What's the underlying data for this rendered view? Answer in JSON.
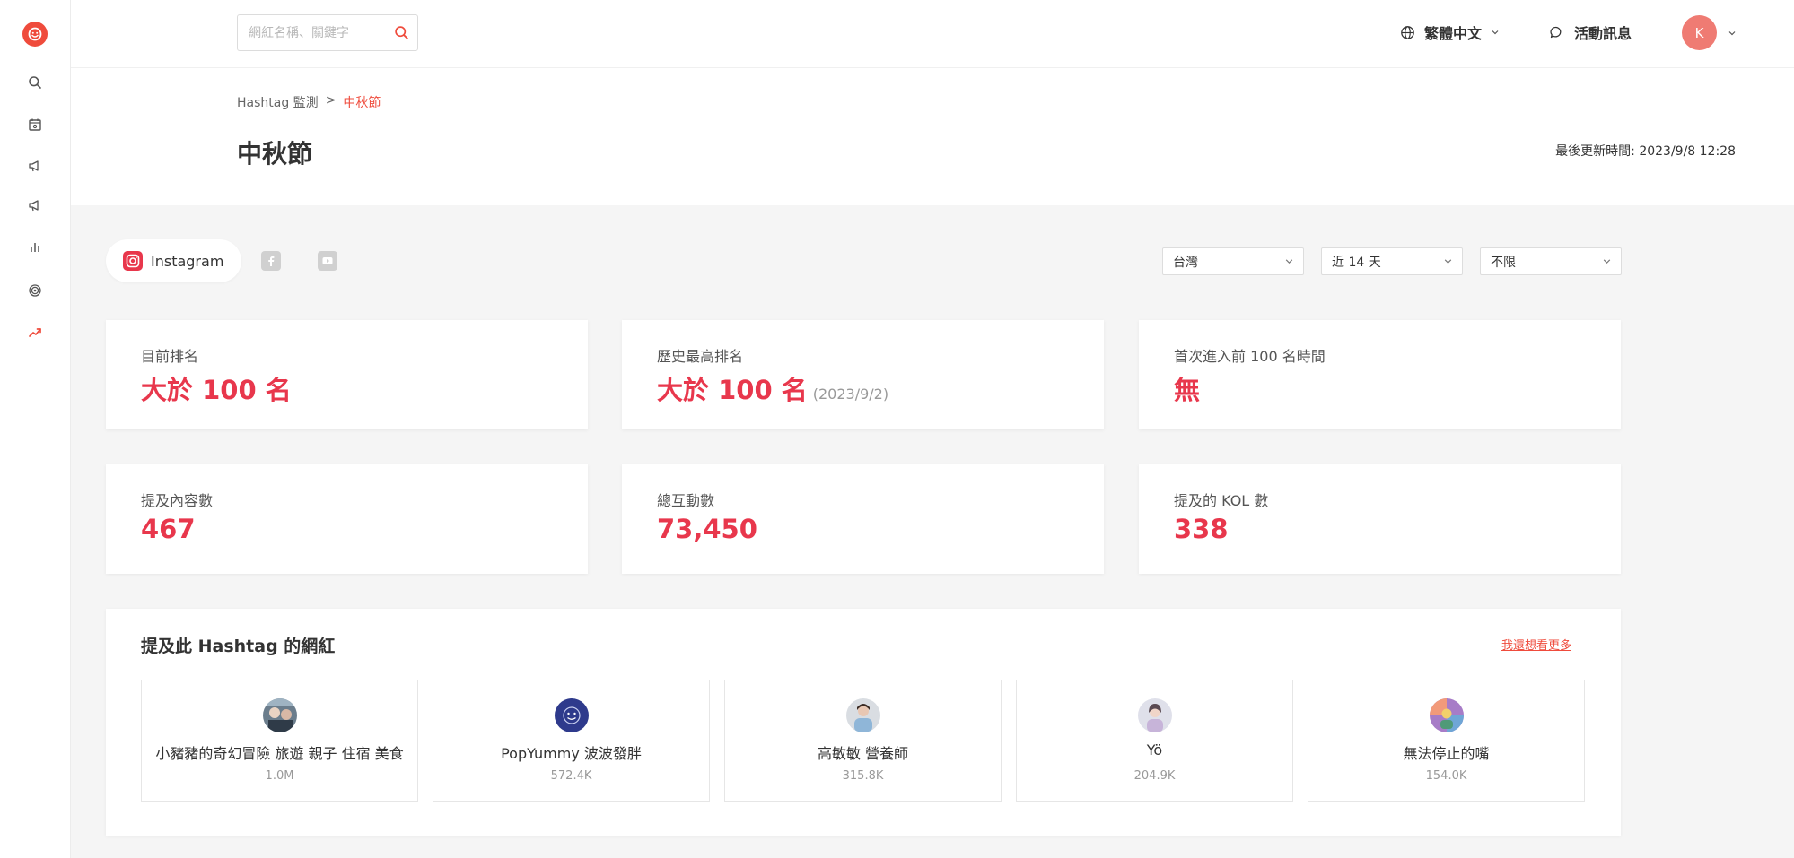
{
  "header": {
    "search_placeholder": "網紅名稱、關鍵字",
    "language": "繁體中文",
    "events_label": "活動訊息",
    "avatar_initial": "K"
  },
  "sidebar": {
    "items": [
      {
        "icon": "search-icon"
      },
      {
        "icon": "calendar-star-icon"
      },
      {
        "icon": "megaphone-icon"
      },
      {
        "icon": "megaphone-alt-icon"
      },
      {
        "icon": "bar-chart-icon"
      },
      {
        "icon": "target-icon"
      },
      {
        "icon": "trending-icon",
        "active": true
      }
    ]
  },
  "breadcrumb": {
    "parent": "Hashtag 監測",
    "separator": ">",
    "current": "中秋節"
  },
  "page": {
    "title": "中秋節",
    "updated": "最後更新時間: 2023/9/8 12:28"
  },
  "platforms": {
    "active": "Instagram",
    "others": [
      "facebook-icon",
      "youtube-icon"
    ]
  },
  "filters": {
    "region": "台灣",
    "period": "近 14 天",
    "limit": "不限"
  },
  "stats": {
    "current_rank": {
      "label": "目前排名",
      "value": "大於 100 名"
    },
    "best_rank": {
      "label": "歷史最高排名",
      "value": "大於 100 名",
      "date": "(2023/9/2)"
    },
    "first_top100": {
      "label": "首次進入前 100 名時間",
      "value": "無"
    },
    "mentions": {
      "label": "提及內容數",
      "value": "467"
    },
    "interactions": {
      "label": "總互動數",
      "value": "73,450"
    },
    "kols": {
      "label": "提及的 KOL 數",
      "value": "338"
    }
  },
  "kol_section": {
    "title": "提及此 Hashtag 的網紅",
    "more_link": "我還想看更多",
    "items": [
      {
        "name": "小豬豬的奇幻冒險 旅遊 親子 住宿 美食",
        "followers": "1.0M"
      },
      {
        "name": "PopYummy 波波發胖",
        "followers": "572.4K"
      },
      {
        "name": "高敏敏 營養師",
        "followers": "315.8K"
      },
      {
        "name": "Yö",
        "followers": "204.9K"
      },
      {
        "name": "無法停止的嘴",
        "followers": "154.0K"
      }
    ]
  },
  "colors": {
    "accent": "#ef4b3c",
    "value_red": "#e8374c",
    "avatar_bg": "#ef7b73"
  }
}
